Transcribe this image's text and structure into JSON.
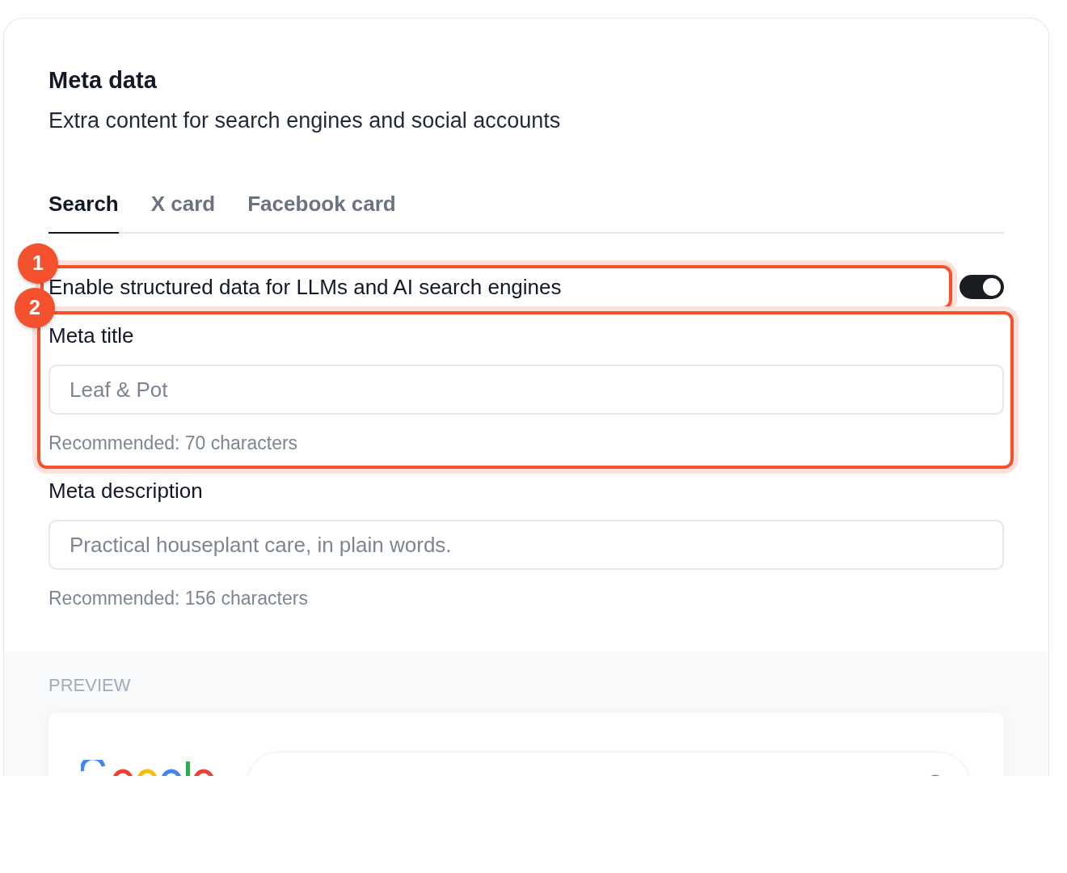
{
  "card": {
    "title": "Meta data",
    "subtitle": "Extra content for search engines and social accounts"
  },
  "tabs": [
    {
      "label": "Search",
      "selected": true
    },
    {
      "label": "X card",
      "selected": false
    },
    {
      "label": "Facebook card",
      "selected": false
    }
  ],
  "structured_data": {
    "label": "Enable structured data for LLMs and AI search engines",
    "enabled": true
  },
  "fields": [
    {
      "label": "Meta title",
      "placeholder": "Leaf & Pot",
      "hint": "Recommended: 70 characters"
    },
    {
      "label": "Meta description",
      "placeholder": "Practical houseplant care, in plain words.",
      "hint": "Recommended: 156 characters"
    }
  ],
  "preview": {
    "heading": "PREVIEW"
  },
  "annotations": [
    {
      "number": "1"
    },
    {
      "number": "2"
    }
  ]
}
